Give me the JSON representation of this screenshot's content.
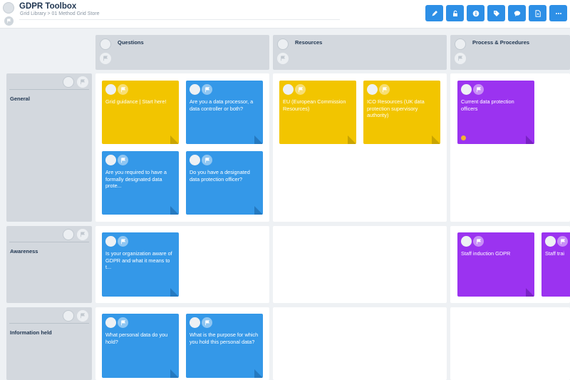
{
  "app": {
    "title": "GDPR Toolbox",
    "breadcrumb": "Grid Library > 01 Method Grid Store"
  },
  "toolbar": [
    {
      "icon": "pencil-icon",
      "name": "edit-button"
    },
    {
      "icon": "lock-icon",
      "name": "lock-button"
    },
    {
      "icon": "info-icon",
      "name": "info-button"
    },
    {
      "icon": "tags-icon",
      "name": "tags-button"
    },
    {
      "icon": "comment-icon",
      "name": "comments-button"
    },
    {
      "icon": "pdf-icon",
      "name": "export-pdf-button"
    },
    {
      "icon": "more-icon",
      "name": "more-button"
    }
  ],
  "columns": [
    {
      "label": "Questions"
    },
    {
      "label": "Resources"
    },
    {
      "label": "Process & Procedures"
    }
  ],
  "rows": [
    {
      "label": "General"
    },
    {
      "label": "Awareness"
    },
    {
      "label": "Information held"
    }
  ],
  "cards": {
    "general_questions": [
      {
        "text": "Grid guidance | Start here!",
        "color": "#f2c500"
      },
      {
        "text": "Are you a data processor, a data controller or both?",
        "color": "#3498e8"
      },
      {
        "text": "Are you required to have a formally designated data prote...",
        "color": "#3498e8"
      },
      {
        "text": "Do you have a designated data protection officer?",
        "color": "#3498e8"
      }
    ],
    "general_resources": [
      {
        "text": "EU (European Commission Resources)",
        "color": "#f2c500"
      },
      {
        "text": "ICO Resources (UK data protection supervisory authority)",
        "color": "#f2c500"
      }
    ],
    "general_process": [
      {
        "text": "Current data protection officers",
        "color": "#9b33f0"
      }
    ],
    "awareness_questions": [
      {
        "text": "Is your organization aware of GDPR and what it means to t...",
        "color": "#3498e8"
      }
    ],
    "awareness_process": [
      {
        "text": "Staff induction GDPR",
        "color": "#9b33f0"
      },
      {
        "text": "Staff trai",
        "color": "#9b33f0"
      }
    ],
    "information_questions": [
      {
        "text": "What personal data do you hold?",
        "color": "#3498e8"
      },
      {
        "text": "What is the purpose for which you hold this personal data?",
        "color": "#3498e8"
      }
    ]
  },
  "colors": {
    "accent": "#2d8fe6",
    "yellow_card": "#f2c500",
    "blue_card": "#3498e8",
    "purple_card": "#9b33f0",
    "header_gray": "#d3d8de"
  }
}
